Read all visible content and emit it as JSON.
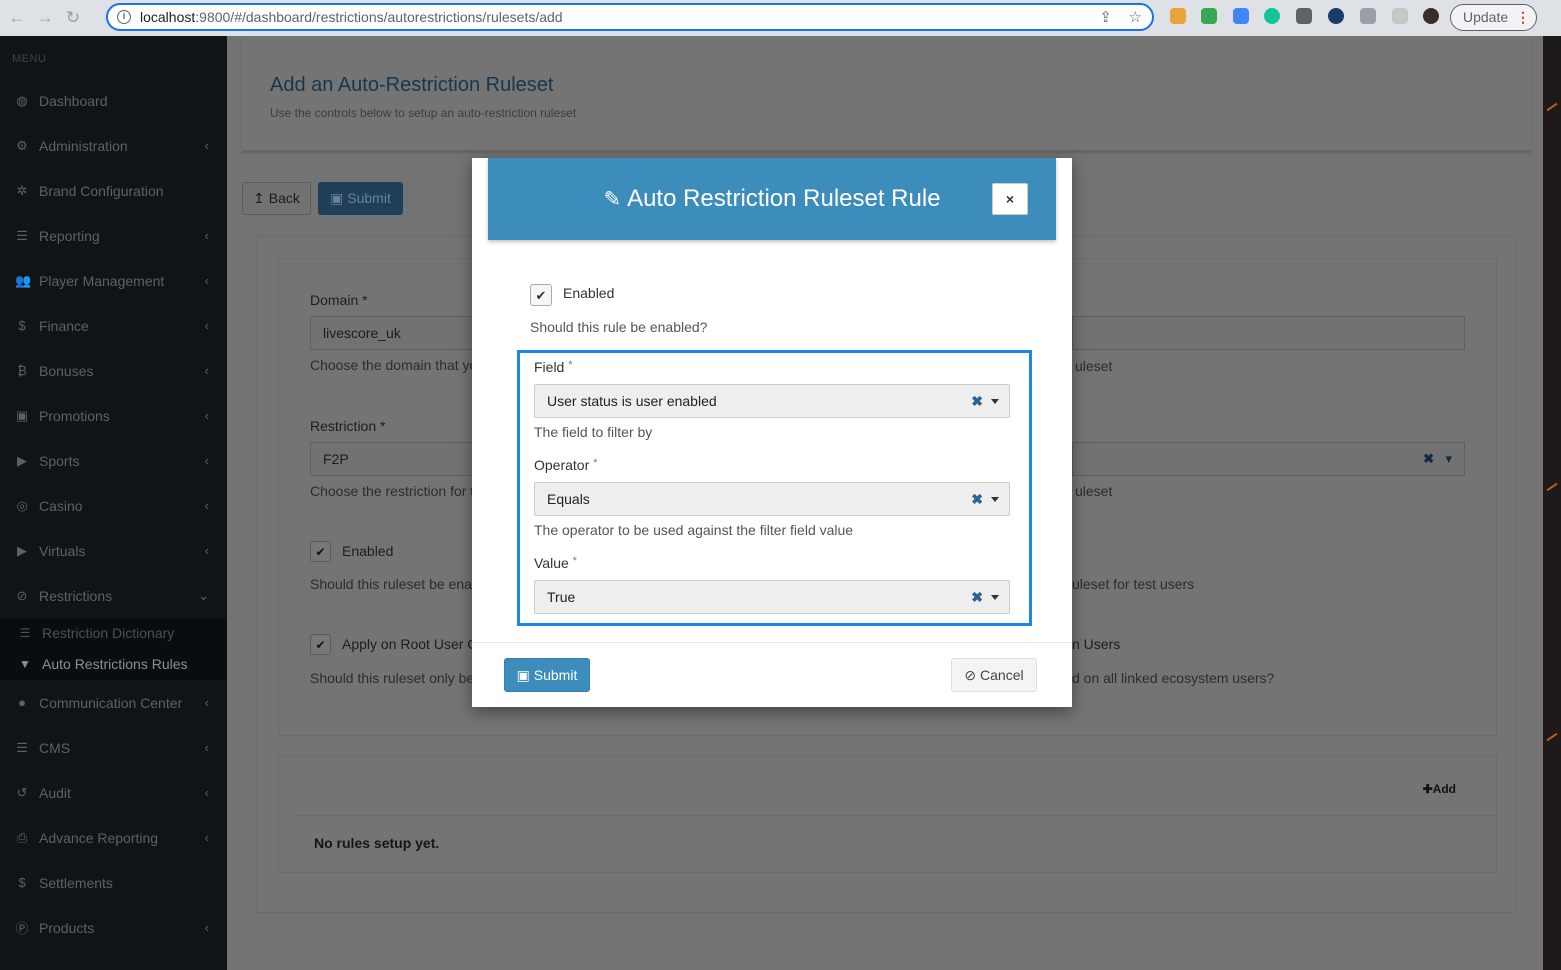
{
  "browser": {
    "url_host": "localhost",
    "url_path": ":9800/#/dashboard/restrictions/autorestrictions/rulesets/add",
    "update_label": "Update",
    "nav_icons": [
      "back-arrow-icon",
      "forward-arrow-icon",
      "reload-icon"
    ],
    "actions": [
      "share-icon",
      "bookmark-star-icon"
    ]
  },
  "sidebar": {
    "menu_label": "MENU",
    "items": [
      {
        "label": "Dashboard",
        "icon": "dashboard-icon",
        "glyph": "◍",
        "chevron": false
      },
      {
        "label": "Administration",
        "icon": "cogs-icon",
        "glyph": "⚙",
        "chevron": true
      },
      {
        "label": "Brand Configuration",
        "icon": "gear-icon",
        "glyph": "✲",
        "chevron": false
      },
      {
        "label": "Reporting",
        "icon": "list-icon",
        "glyph": "☰",
        "chevron": true
      },
      {
        "label": "Player Management",
        "icon": "users-icon",
        "glyph": "👥",
        "chevron": true
      },
      {
        "label": "Finance",
        "icon": "dollar-icon",
        "glyph": "$",
        "chevron": true
      },
      {
        "label": "Bonuses",
        "icon": "bitcoin-icon",
        "glyph": "₿",
        "chevron": true
      },
      {
        "label": "Promotions",
        "icon": "money-icon",
        "glyph": "▣",
        "chevron": true
      },
      {
        "label": "Sports",
        "icon": "play-circle-icon",
        "glyph": "▶",
        "chevron": true
      },
      {
        "label": "Casino",
        "icon": "gamepad-icon",
        "glyph": "◎",
        "chevron": true
      },
      {
        "label": "Virtuals",
        "icon": "play-circle-icon",
        "glyph": "▶",
        "chevron": true
      },
      {
        "label": "Restrictions",
        "icon": "ban-icon",
        "glyph": "⊘",
        "chevron": true
      }
    ],
    "sub_items": [
      {
        "label": "Restriction Dictionary",
        "icon": "list-icon",
        "glyph": "☰"
      },
      {
        "label": "Auto Restrictions Rules",
        "icon": "filter-icon",
        "glyph": "▼"
      }
    ],
    "items_after": [
      {
        "label": "Communication Center",
        "icon": "comment-icon",
        "glyph": "●",
        "chevron": true
      },
      {
        "label": "CMS",
        "icon": "list-icon",
        "glyph": "☰",
        "chevron": true
      },
      {
        "label": "Audit",
        "icon": "history-icon",
        "glyph": "↺",
        "chevron": true
      },
      {
        "label": "Advance Reporting",
        "icon": "print-icon",
        "glyph": "⎙",
        "chevron": true
      },
      {
        "label": "Settlements",
        "icon": "dollar-icon",
        "glyph": "$",
        "chevron": false
      },
      {
        "label": "Products",
        "icon": "product-icon",
        "glyph": "Ⓟ",
        "chevron": true
      }
    ]
  },
  "page": {
    "title": "Add an Auto-Restriction Ruleset",
    "subtitle": "Use the controls below to setup an auto-restriction ruleset",
    "back_label": "Back",
    "submit_label": "Submit"
  },
  "form": {
    "domain_label": "Domain *",
    "domain_value": "livescore_uk",
    "domain_hint": "Choose the domain that yo",
    "name_hint_tail": "uleset",
    "restriction_label": "Restriction *",
    "restriction_value": "F2P",
    "restriction_hint": "Choose the restriction for t",
    "restriction_hint_tail": "uleset",
    "enabled_label": "Enabled",
    "enabled_hint": "Should this ruleset be ena",
    "test_users_hint_tail": "uleset for test users",
    "apply_root_label": "Apply on Root User C",
    "apply_root_hint": "Should this ruleset only be",
    "linked_users_label_tail": "n Users",
    "linked_users_hint_tail": "d on all linked ecosystem users?",
    "add_label": "Add",
    "no_rules": "No rules setup yet."
  },
  "modal": {
    "title": "Auto Restriction Ruleset Rule",
    "close_label": "×",
    "enabled_label": "Enabled",
    "enabled_checked": true,
    "enabled_hint": "Should this rule be enabled?",
    "field": {
      "label": "Field",
      "value": "User status is user enabled",
      "hint": "The field to filter by"
    },
    "operator": {
      "label": "Operator",
      "value": "Equals",
      "hint": "The operator to be used against the filter field value"
    },
    "value": {
      "label": "Value",
      "value": "True"
    },
    "required_mark": "*",
    "submit_label": "Submit",
    "cancel_label": "Cancel"
  },
  "colors": {
    "modal_header": "#3c8dbc",
    "rule_box_border": "#1e88e5",
    "sidebar_bg": "#101416"
  }
}
